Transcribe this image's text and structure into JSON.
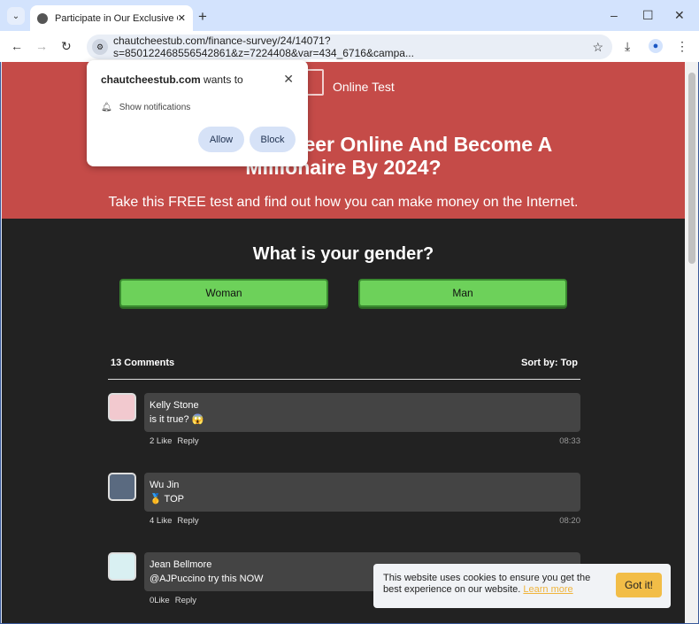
{
  "browser": {
    "tab_title": "Participate in Our Exclusive Onl",
    "url": "chautcheestub.com/finance-survey/24/14071?s=850122468556542861&z=7224408&var=434_6716&campa..."
  },
  "hero": {
    "brand": "Online Test",
    "headline_line1": "Want To Start Career Online And Become A",
    "headline_line2": "Millionaire By 2024?",
    "subtitle": "Take this FREE test and find out how you can make money on the Internet."
  },
  "survey": {
    "question": "What is your gender?",
    "options": [
      "Woman",
      "Man"
    ],
    "button_color": "#6dd15a"
  },
  "comments": {
    "count": "13 Comments",
    "sort": "Sort by: Top",
    "items": [
      {
        "name": "Kelly Stone",
        "text": "is it true? 😱",
        "likes": "2 Like",
        "reply": "Reply",
        "time": "08:33"
      },
      {
        "name": "Wu Jin",
        "text": "🥇 TOP",
        "likes": "4 Like",
        "reply": "Reply",
        "time": "08:20"
      },
      {
        "name": "Jean Bellmore",
        "text": "@AJPuccino try this NOW",
        "likes": "0Like",
        "reply": "Reply",
        "time": ""
      }
    ]
  },
  "cookie": {
    "text": "This website uses cookies to ensure you get the best experience on our website.",
    "link": "Learn more",
    "button": "Got it!"
  },
  "popup": {
    "site": "chautcheestub.com",
    "wants": " wants to",
    "permission": "Show notifications",
    "allow": "Allow",
    "block": "Block"
  },
  "colors": {
    "hero": "#c54b48",
    "page": "#222222",
    "accent": "#f2bd47"
  }
}
